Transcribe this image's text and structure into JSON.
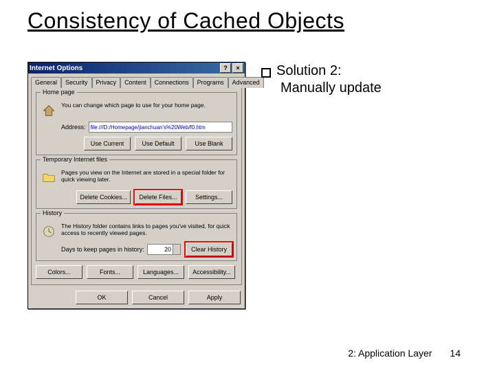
{
  "slide": {
    "title": "Consistency of Cached Objects",
    "bullet": {
      "head": "Solution 2:",
      "sub": "Manually update"
    },
    "footer": {
      "section": "2: Application Layer",
      "page": "14"
    }
  },
  "dialog": {
    "title": "Internet Options",
    "titlebar": {
      "help": "?",
      "close": "×"
    },
    "tabs": [
      "General",
      "Security",
      "Privacy",
      "Content",
      "Connections",
      "Programs",
      "Advanced"
    ],
    "active_tab": "General",
    "home": {
      "legend": "Home page",
      "desc": "You can change which page to use for your home page.",
      "addr_label": "Address:",
      "addr_value": "file:///D:/Homepage/jianchuan's%20Web/f0.htm",
      "buttons": {
        "current": "Use Current",
        "default": "Use Default",
        "blank": "Use Blank"
      }
    },
    "temp": {
      "legend": "Temporary Internet files",
      "desc": "Pages you view on the Internet are stored in a special folder for quick viewing later.",
      "buttons": {
        "cookies": "Delete Cookies...",
        "files": "Delete Files...",
        "settings": "Settings..."
      }
    },
    "history": {
      "legend": "History",
      "desc": "The History folder contains links to pages you've visited, for quick access to recently viewed pages.",
      "days_label": "Days to keep pages in history:",
      "days_value": "20",
      "clear": "Clear History"
    },
    "bottom": {
      "colors": "Colors...",
      "fonts": "Fonts...",
      "languages": "Languages...",
      "access": "Accessibility..."
    },
    "actions": {
      "ok": "OK",
      "cancel": "Cancel",
      "apply": "Apply"
    }
  }
}
